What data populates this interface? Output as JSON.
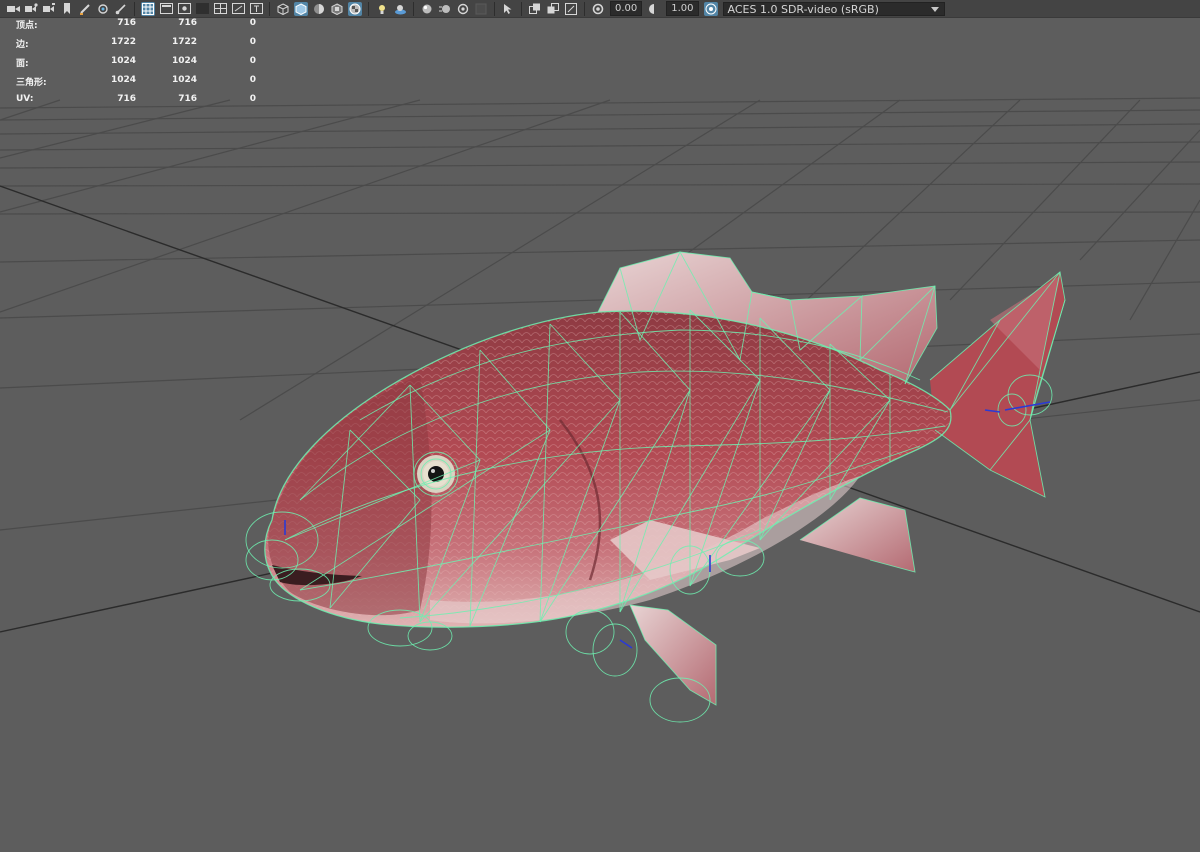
{
  "toolbar": {
    "exposure_value": "0.00",
    "gamma_value": "1.00",
    "color_space": "ACES 1.0 SDR-video (sRGB)",
    "icons": [
      "camera-icon",
      "camera-attributes-icon",
      "bookmark-icon",
      "grease-pencil-icon",
      "wireframe-shaded-icon",
      "grid-icon",
      "film-gate-icon",
      "resolution-gate-icon",
      "gate-mask-icon",
      "field-chart-icon",
      "safe-action-icon",
      "safe-title-icon",
      "wireframe-icon",
      "smooth-shade-icon",
      "default-material-icon",
      "textured-icon",
      "use-all-lights-icon",
      "shadows-icon",
      "screen-space-ao-icon",
      "motion-blur-icon",
      "antialias-icon",
      "isolate-select-icon",
      "xray-icon",
      "xray-joints-icon",
      "backface-culling-icon",
      "exposure-icon",
      "gamma-icon",
      "color-management-icon"
    ]
  },
  "hud": {
    "rows": [
      {
        "label": "顶点:",
        "v1": "716",
        "v2": "716",
        "v3": "0"
      },
      {
        "label": "边:",
        "v1": "1722",
        "v2": "1722",
        "v3": "0"
      },
      {
        "label": "面:",
        "v1": "1024",
        "v2": "1024",
        "v3": "0"
      },
      {
        "label": "三角形:",
        "v1": "1024",
        "v2": "1024",
        "v3": "0"
      },
      {
        "label": "UV:",
        "v1": "716",
        "v2": "716",
        "v3": "0"
      }
    ]
  },
  "viewport": {
    "background_color": "#5d5d5d",
    "grid_color": "#4b4b4b",
    "axis_color": "#2a2a2a",
    "wireframe_color": "#6ff0b0",
    "fish_colors": [
      "#b24a53",
      "#c7727a",
      "#8e3a42",
      "#e0b4b4"
    ]
  }
}
